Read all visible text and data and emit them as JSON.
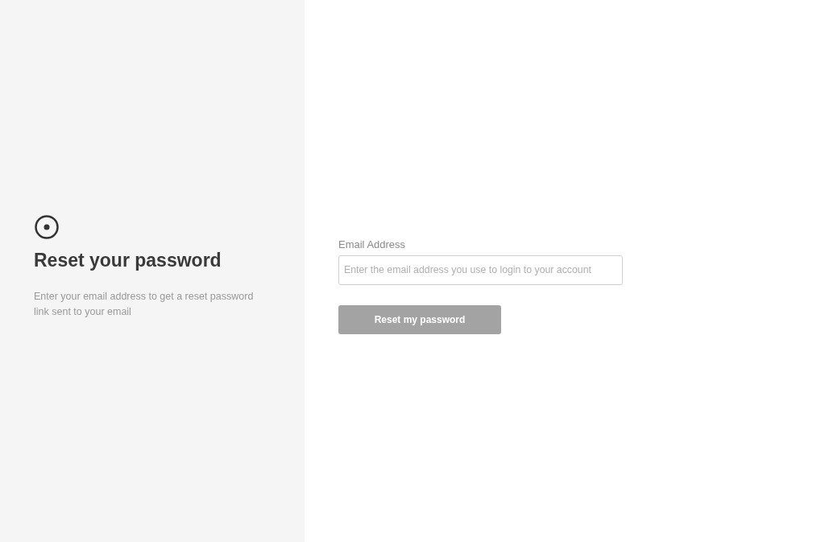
{
  "intro": {
    "title": "Reset your password",
    "description": "Enter your email address to get a reset password link sent to your email"
  },
  "form": {
    "email_label": "Email Address",
    "email_placeholder": "Enter the email address you use to login to your account",
    "submit": {
      "label": "Reset my password",
      "disabled": true
    }
  }
}
